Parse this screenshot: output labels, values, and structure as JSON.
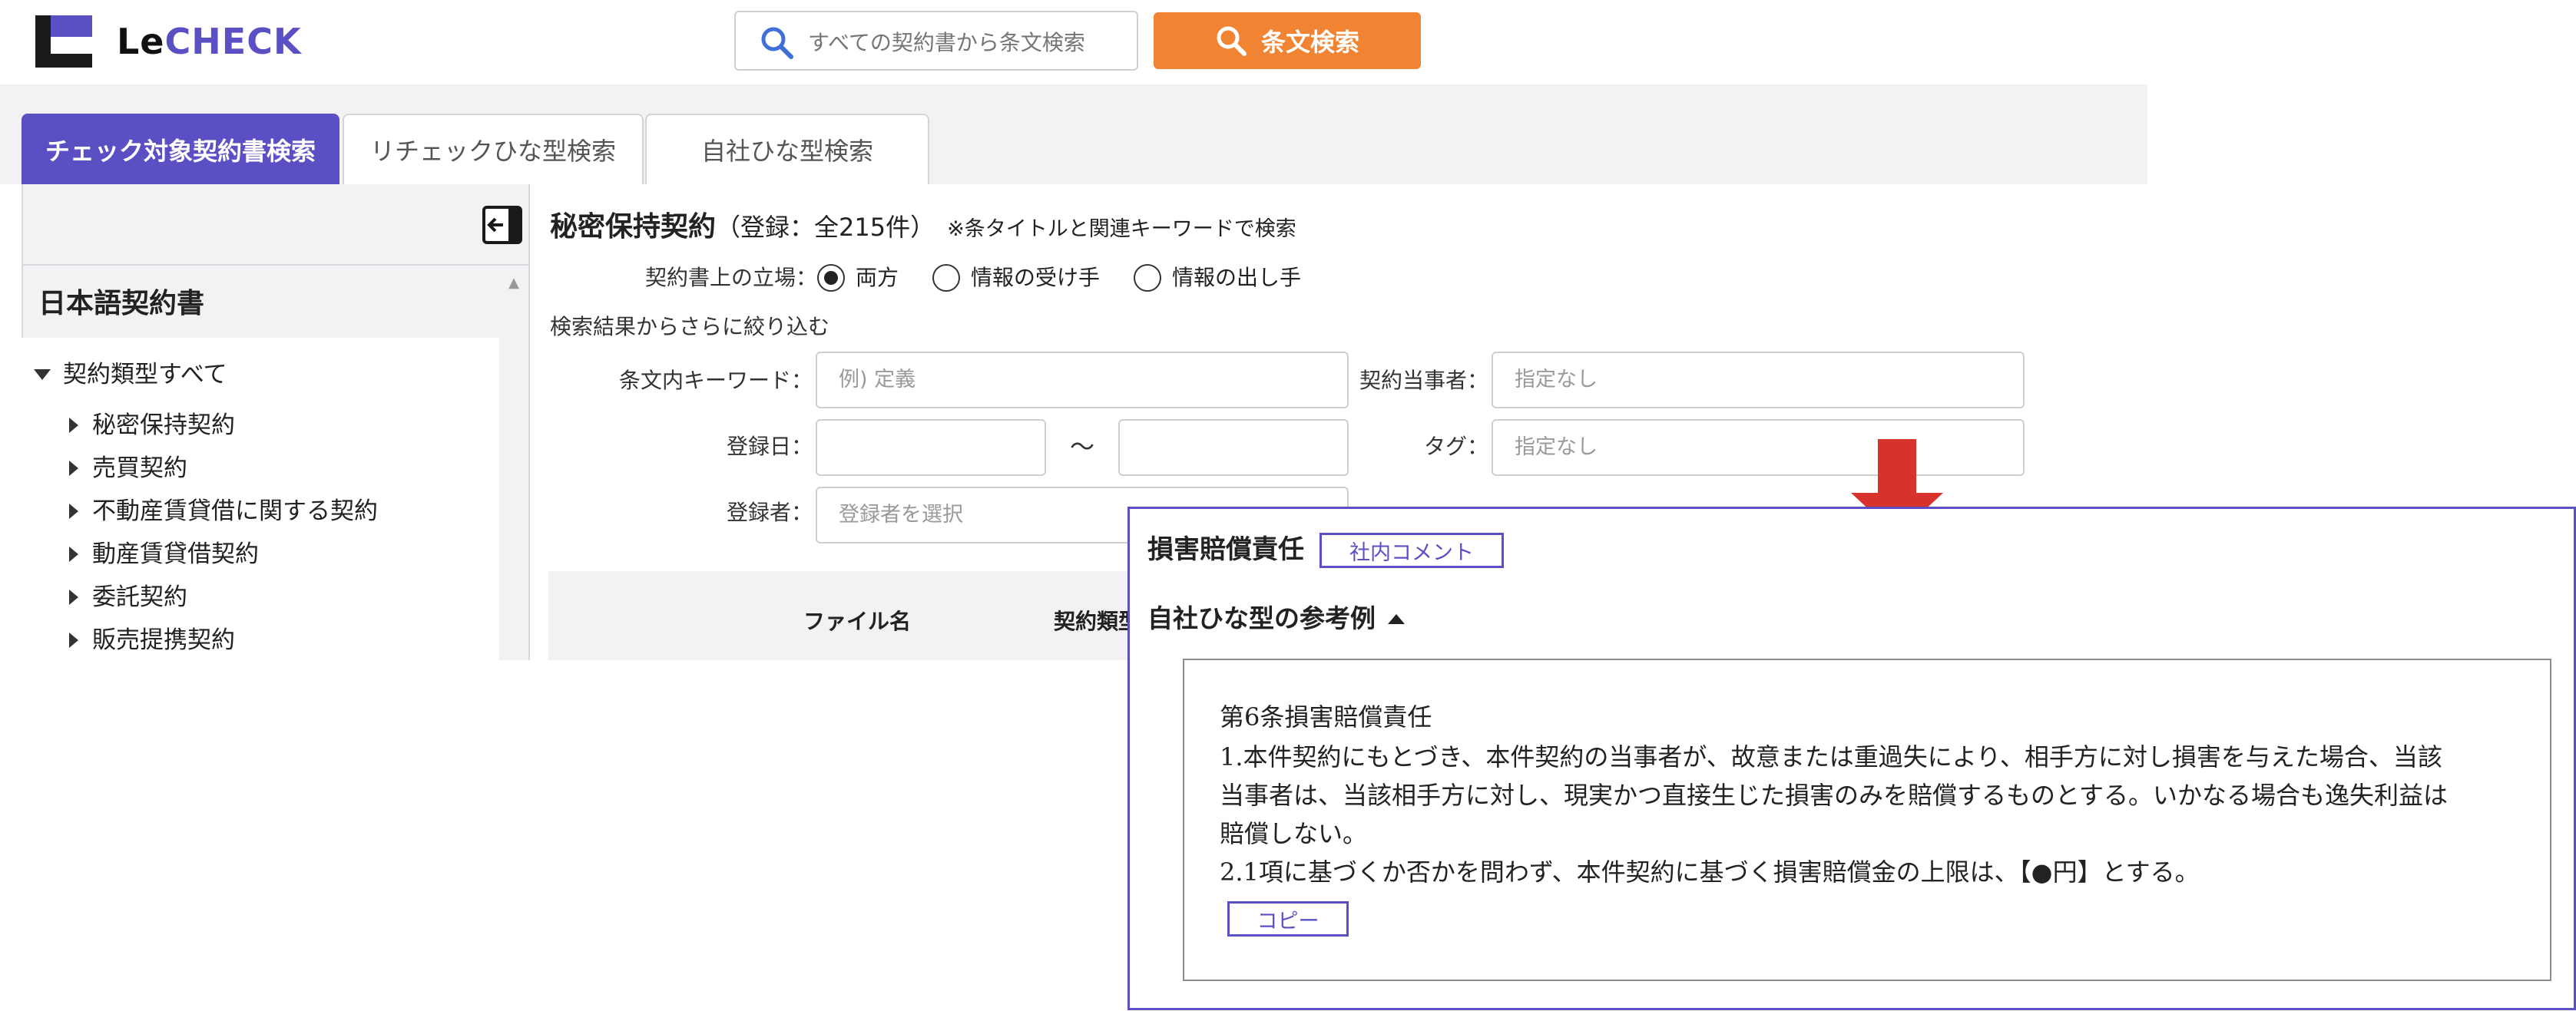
{
  "header": {
    "logo_le": "Le",
    "logo_check": "CHECK",
    "search_placeholder": "すべての契約書から条文検索",
    "search_button_label": "条文検索"
  },
  "tabs": [
    {
      "label": "チェック対象契約書検索",
      "active": true
    },
    {
      "label": "リチェックひな型検索",
      "active": false
    },
    {
      "label": "自社ひな型検索",
      "active": false
    }
  ],
  "sidebar": {
    "title": "日本語契約書",
    "root_label": "契約類型すべて",
    "items": [
      {
        "label": "秘密保持契約"
      },
      {
        "label": "売買契約"
      },
      {
        "label": "不動産賃貸借に関する契約"
      },
      {
        "label": "動産賃貸借契約"
      },
      {
        "label": "委託契約"
      },
      {
        "label": "販売提携契約"
      }
    ]
  },
  "main": {
    "title": "秘密保持契約",
    "count": "（登録：全215件）",
    "note": "※条タイトルと関連キーワードで検索",
    "position_label": "契約書上の立場：",
    "positions": [
      {
        "label": "両方",
        "selected": true
      },
      {
        "label": "情報の受け手",
        "selected": false
      },
      {
        "label": "情報の出し手",
        "selected": false
      }
    ],
    "narrow_label": "検索結果からさらに絞り込む",
    "keyword_label": "条文内キーワード：",
    "keyword_placeholder": "例) 定義",
    "party_label": "契約当事者：",
    "party_placeholder": "指定なし",
    "date_label": "登録日：",
    "date_sep": "～",
    "tag_label": "タグ：",
    "tag_placeholder": "指定なし",
    "registrant_label": "登録者：",
    "registrant_placeholder": "登録者を選択",
    "col_filename": "ファイル名",
    "col_type": "契約類型"
  },
  "popup": {
    "title": "損害賠償責任",
    "comment_button": "社内コメント",
    "ref_title": "自社ひな型の参考例",
    "lines": [
      "第6条損害賠償責任",
      "1.本件契約にもとづき、本件契約の当事者が、故意または重過失により、相手方に対し損害を与えた場合、当該",
      "当事者は、当該相手方に対し、現実かつ直接生じた損害のみを賠償するものとする。いかなる場合も逸失利益は",
      "賠償しない。",
      "2.1項に基づくか否かを問わず、本件契約に基づく損害賠償金の上限は、【●円】とする。"
    ],
    "copy_button": "コピー"
  },
  "colors": {
    "brand": "#5b4fc4",
    "search_button": "#f08432",
    "arrow": "#d8322c",
    "panel_bg": "#f2f2f4"
  },
  "icons": {
    "logo": "lecheck-logo-icon",
    "search": "search-icon",
    "collapse": "collapse-sidebar-icon",
    "arrow": "down-arrow-icon"
  }
}
